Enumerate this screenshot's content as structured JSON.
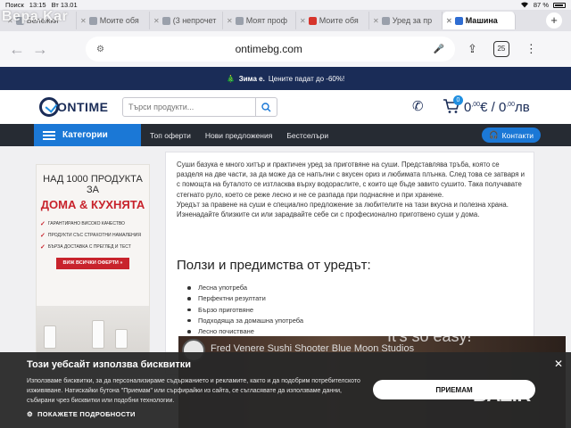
{
  "status_bar": {
    "left": [
      "Поиск",
      "13:15",
      "Вт 13.01"
    ],
    "battery": "87 %"
  },
  "tabs": [
    {
      "label": "Бележки",
      "favicon": "grey"
    },
    {
      "label": "Моите обя",
      "favicon": "grey"
    },
    {
      "label": "(3 непрочет",
      "favicon": "grey"
    },
    {
      "label": "Моят проф",
      "favicon": "grey"
    },
    {
      "label": "Моите обя",
      "favicon": "red"
    },
    {
      "label": "Уред за пр",
      "favicon": "grey"
    },
    {
      "label": "Машина",
      "favicon": "blue",
      "active": true
    }
  ],
  "watermark": "Bepa.Kar",
  "address": {
    "url": "ontimebg.com",
    "tab_count": "25"
  },
  "promo": {
    "emoji": "🎄",
    "bold": "Зима е.",
    "text": "Цените падат до -60%!"
  },
  "header": {
    "logo": "ONTIME",
    "search_placeholder": "Търси продукти...",
    "cart_count": "0",
    "cart_eur_int": "0",
    "cart_eur_dec": ",00",
    "cart_eur_cur": "€ / ",
    "cart_lv_int": "0",
    "cart_lv_dec": ",00",
    "cart_lv_cur": "лв"
  },
  "nav": {
    "categories": "Категории",
    "links": [
      "Топ оферти",
      "Нови предложения",
      "Бестселъри"
    ],
    "contacts": "Контакти"
  },
  "banner": {
    "line1": "НАД 1000 ПРОДУКТА ЗА",
    "line2": "ДОМА & КУХНЯТА",
    "items": [
      "ГАРАНТИРАНО ВИСОКО КАЧЕСТВО",
      "ПРОДУКТИ СЪС СТРАХОТНИ НАМАЛЕНИЯ",
      "БЪРЗА ДОСТАВКА С ПРЕГЛЕД И ТЕСТ"
    ],
    "button": "ВИЖ ВСИЧКИ ОФЕРТИ »"
  },
  "content": {
    "paragraph1": "Суши базука е много хитър и практичен уред за приготвяне на суши. Представлява тръба, която се разделя на две части, за да може да се напълни с вкусен ориз и любимата плънка. След това се затваря и с помощта на буталото се изтласква върху водораслите, с които ще бъде завито сушито. Така получавате стегнато руло, което се реже лесно и не се разпада при поднасяне и при хранене.",
    "paragraph2": "Уредът за правене на суши е специално предложение за любителите на тази вкусна и полезна храна. Изненадайте близките си или зарадвайте себе си с професионално приготвено суши у дома.",
    "benefits_title": "Ползи и предимства от уредът:",
    "benefits": [
      "Лесна употреба",
      "Перфектни резултати",
      "Бързо приготвяне",
      "Подходяща за домашна употреба",
      "Лесно почистване"
    ]
  },
  "video": {
    "title": "Fred Venere Sushi Shooter Blue Moon Studios",
    "overlay": "It's so easy!"
  },
  "cookie": {
    "title": "Този уебсайт използва бисквитки",
    "text": "Използваме бисквитки, за да персонализираме съдържанието и рекламите, както и да подобрим потребителското изживяване. Натискайки бутона \"Приемам\" или сърфирайки из сайта, се съгласявате да използваме данни, събирани чрез бисквитки или подобни технологии.",
    "details": "ПОКАЖЕТЕ ПОДРОБНОСТИ",
    "accept": "ПРИЕМАМ"
  },
  "bazar_logo": "BAZ.R"
}
